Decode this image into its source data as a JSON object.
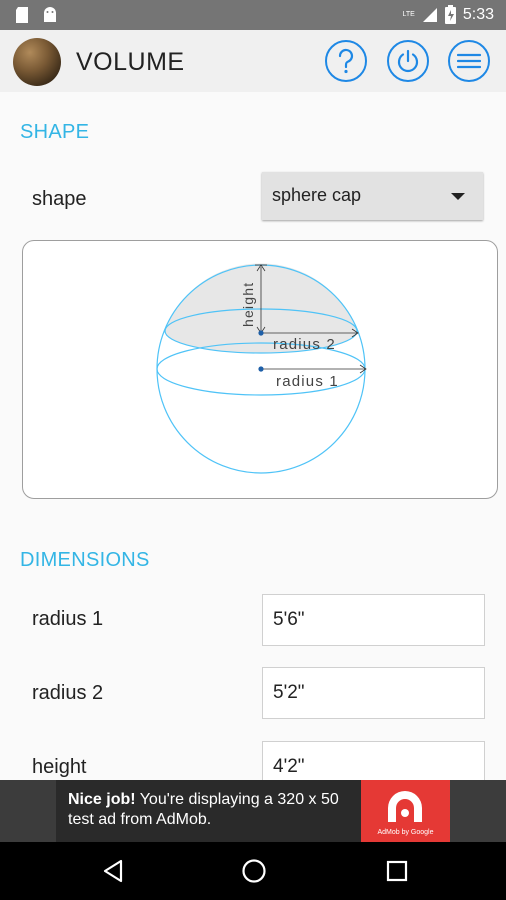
{
  "status_bar": {
    "time": "5:33",
    "network_label": "LTE",
    "icons": [
      "sd-card-icon",
      "android-icon",
      "signal-icon",
      "battery-icon"
    ]
  },
  "action_bar": {
    "title": "VOLUME",
    "buttons": [
      "help-icon",
      "power-icon",
      "menu-icon"
    ]
  },
  "shape_section": {
    "header": "SHAPE",
    "label": "shape",
    "selected": "sphere cap"
  },
  "diagram": {
    "labels": {
      "height": "height",
      "radius2": "radius 2",
      "radius1": "radius 1"
    }
  },
  "dimensions_section": {
    "header": "DIMENSIONS",
    "fields": [
      {
        "label": "radius 1",
        "value": "5'6\""
      },
      {
        "label": "radius 2",
        "value": "5'2\""
      },
      {
        "label": "height",
        "value": "4'2\""
      }
    ]
  },
  "ad": {
    "headline": "Nice job!",
    "text": " You're displaying a 320 x 50 test ad from AdMob.",
    "logo_caption": "AdMob by Google"
  },
  "colors": {
    "accent": "#33b5e5",
    "button_blue": "#1e88e5",
    "diagram_line": "#4fc3f7",
    "ad_red": "#e53935"
  }
}
